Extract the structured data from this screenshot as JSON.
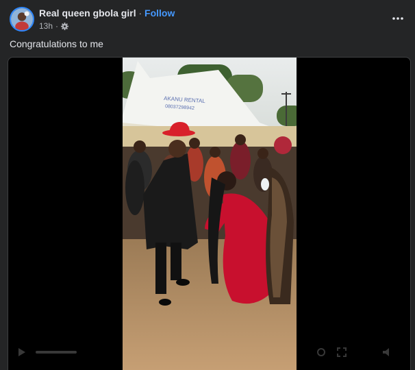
{
  "post": {
    "author_name": "Real queen gbola girl",
    "separator": "·",
    "follow_label": "Follow",
    "timestamp": "13h",
    "audience_icon": "gear-icon",
    "more_icon": "more-icon",
    "caption": "Congratulations to me"
  },
  "video": {
    "tent_text_line1": "AKANU RENTAL",
    "tent_text_line2": "08037298942"
  },
  "colors": {
    "background": "#242526",
    "follow": "#4599ff",
    "text": "#e4e6eb",
    "secondary_text": "#b0b3b8"
  }
}
